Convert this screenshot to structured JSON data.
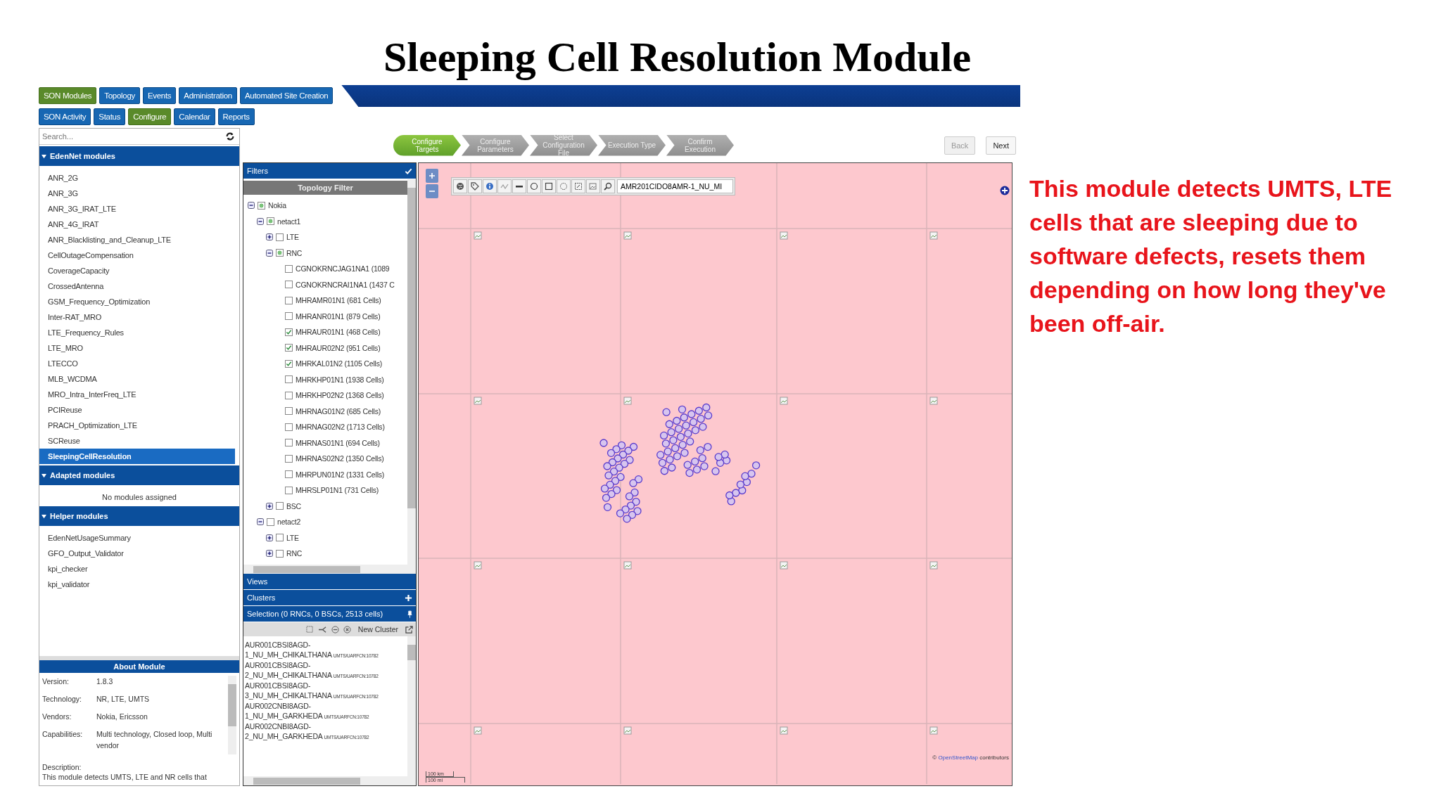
{
  "slide_title": "Sleeping Cell Resolution Module",
  "app": {
    "nav_tabs": [
      {
        "label": "SON Modules",
        "selected": true
      },
      {
        "label": "Topology",
        "selected": false
      },
      {
        "label": "Events",
        "selected": false
      },
      {
        "label": "Administration",
        "selected": false
      },
      {
        "label": "Automated Site Creation",
        "selected": false
      }
    ],
    "nav_subtabs": [
      {
        "label": "SON Activity",
        "selected": false
      },
      {
        "label": "Status",
        "selected": false
      },
      {
        "label": "Configure",
        "selected": true
      },
      {
        "label": "Calendar",
        "selected": false
      },
      {
        "label": "Reports",
        "selected": false
      }
    ],
    "sidebar": {
      "search": {
        "placeholder": "Search..."
      },
      "sections": [
        {
          "title": "EdenNet modules",
          "expanded": true,
          "items": [
            {
              "label": "ANR_2G",
              "selected": false
            },
            {
              "label": "ANR_3G",
              "selected": false
            },
            {
              "label": "ANR_3G_IRAT_LTE",
              "selected": false
            },
            {
              "label": "ANR_4G_IRAT",
              "selected": false
            },
            {
              "label": "ANR_Blacklisting_and_Cleanup_LTE",
              "selected": false
            },
            {
              "label": "CellOutageCompensation",
              "selected": false
            },
            {
              "label": "CoverageCapacity",
              "selected": false
            },
            {
              "label": "CrossedAntenna",
              "selected": false
            },
            {
              "label": "GSM_Frequency_Optimization",
              "selected": false
            },
            {
              "label": "Inter-RAT_MRO",
              "selected": false
            },
            {
              "label": "LTE_Frequency_Rules",
              "selected": false
            },
            {
              "label": "LTE_MRO",
              "selected": false
            },
            {
              "label": "LTECCO",
              "selected": false
            },
            {
              "label": "MLB_WCDMA",
              "selected": false
            },
            {
              "label": "MRO_Intra_InterFreq_LTE",
              "selected": false
            },
            {
              "label": "PCIReuse",
              "selected": false
            },
            {
              "label": "PRACH_Optimization_LTE",
              "selected": false
            },
            {
              "label": "SCReuse",
              "selected": false
            },
            {
              "label": "SleepingCellResolution",
              "selected": true
            }
          ]
        },
        {
          "title": "Adapted modules",
          "expanded": true,
          "empty_text": "No modules assigned"
        },
        {
          "title": "Helper modules",
          "expanded": true,
          "items": [
            {
              "label": "EdenNetUsageSummary",
              "selected": false
            },
            {
              "label": "GFO_Output_Validator",
              "selected": false
            },
            {
              "label": "kpi_checker",
              "selected": false
            },
            {
              "label": "kpi_validator",
              "selected": false
            }
          ]
        }
      ]
    },
    "about": {
      "title": "About Module",
      "fields": [
        {
          "label": "Version:",
          "value": "1.8.3"
        },
        {
          "label": "Technology:",
          "value": "NR, LTE, UMTS"
        },
        {
          "label": "Vendors:",
          "value": "Nokia, Ericsson"
        },
        {
          "label": "Capabilities:",
          "value": "Multi technology, Closed loop, Multi vendor"
        }
      ],
      "description_label": "Description:",
      "description": "This module detects UMTS, LTE and NR cells that"
    },
    "wizard": {
      "steps": [
        {
          "label": "Configure Targets",
          "selected": true
        },
        {
          "label": "Configure Parameters",
          "selected": false
        },
        {
          "label": "Select Configuration File",
          "selected": false
        },
        {
          "label": "Execution Type",
          "selected": false
        },
        {
          "label": "Confirm Execution",
          "selected": false
        }
      ],
      "buttons": [
        {
          "label": "Back",
          "disabled": true
        },
        {
          "label": "Next",
          "disabled": false
        }
      ]
    },
    "filters": {
      "title": "Filters",
      "topology_title": "Topology Filter",
      "tree": [
        {
          "label": "Nokia",
          "expanded": true,
          "partial": true,
          "children": [
            {
              "label": "netact1",
              "expanded": true,
              "partial": true,
              "children": [
                {
                  "label": "LTE",
                  "expanded": false,
                  "checked": false
                },
                {
                  "label": "RNC",
                  "expanded": true,
                  "partial": true,
                  "children": [
                    {
                      "label": "CGNOKRNCJAG1NA1 (1089",
                      "checked": false
                    },
                    {
                      "label": "CGNOKRNCRAI1NA1 (1437 C",
                      "checked": false
                    },
                    {
                      "label": "MHRAMR01N1 (681 Cells)",
                      "checked": false
                    },
                    {
                      "label": "MHRANR01N1 (879 Cells)",
                      "checked": false
                    },
                    {
                      "label": "MHRAUR01N1 (468 Cells)",
                      "checked": true
                    },
                    {
                      "label": "MHRAUR02N2 (951 Cells)",
                      "checked": true
                    },
                    {
                      "label": "MHRKAL01N2 (1105 Cells)",
                      "checked": true
                    },
                    {
                      "label": "MHRKHP01N1 (1938 Cells)",
                      "checked": false
                    },
                    {
                      "label": "MHRKHP02N2 (1368 Cells)",
                      "checked": false
                    },
                    {
                      "label": "MHRNAG01N2 (685 Cells)",
                      "checked": false
                    },
                    {
                      "label": "MHRNAG02N2 (1713 Cells)",
                      "checked": false
                    },
                    {
                      "label": "MHRNAS01N1 (694 Cells)",
                      "checked": false
                    },
                    {
                      "label": "MHRNAS02N2 (1350 Cells)",
                      "checked": false
                    },
                    {
                      "label": "MHRPUN01N2 (1331 Cells)",
                      "checked": false
                    },
                    {
                      "label": "MHRSLP01N1 (731 Cells)",
                      "checked": false
                    }
                  ]
                },
                {
                  "label": "BSC",
                  "expanded": false,
                  "checked": false
                }
              ]
            },
            {
              "label": "netact2",
              "expanded": true,
              "checked": false,
              "children": [
                {
                  "label": "LTE",
                  "expanded": false,
                  "checked": false
                },
                {
                  "label": "RNC",
                  "expanded": false,
                  "checked": false
                }
              ]
            }
          ]
        }
      ]
    },
    "views_title": "Views",
    "clusters_title": "Clusters",
    "selection_title": "Selection (0 RNCs, 0 BSCs, 2513 cells)",
    "new_cluster": "New Cluster",
    "cells": [
      {
        "name": "AUR001CBSI8AGD-1_NU_MH_CHIKALTHANA",
        "tag": "UMTS/UARFCN:10782"
      },
      {
        "name": "AUR001CBSI8AGD-2_NU_MH_CHIKALTHANA",
        "tag": "UMTS/UARFCN:10782"
      },
      {
        "name": "AUR001CBSI8AGD-3_NU_MH_CHIKALTHANA",
        "tag": "UMTS/UARFCN:10782"
      },
      {
        "name": "AUR002CNBI8AGD-1_NU_MH_GARKHEDA",
        "tag": "UMTS/UARFCN:10782"
      },
      {
        "name": "AUR002CNBI8AGD-2_NU_MH_GARKHEDA",
        "tag": "UMTS/UARFCN:10782"
      }
    ],
    "map": {
      "search_value": "AMR201CIDO8AMR-1_NU_MI",
      "scale_km": "100 km",
      "scale_mi": "100 mi",
      "copyright": "©",
      "attribution_link": "OpenStreetMap",
      "attribution_text": "contributors"
    }
  },
  "annotation": "This module detects UMTS, LTE cells that are sleeping due to software defects, resets them depending on how long they've been off-air."
}
